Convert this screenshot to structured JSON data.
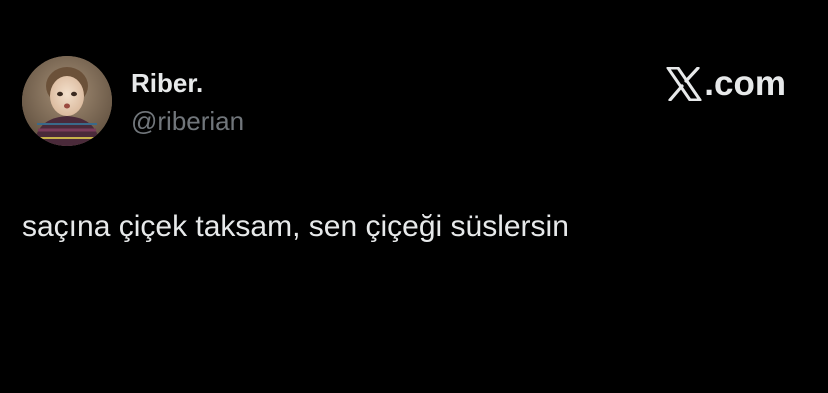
{
  "tweet": {
    "author": {
      "display_name": "Riber.",
      "handle": "@riberian",
      "avatar_icon": "child-portrait-avatar"
    },
    "brand": {
      "icon": "x-logo-icon",
      "label": ".com"
    },
    "text": "saçına çiçek taksam, sen çiçeği süslersin"
  },
  "colors": {
    "background": "#000000",
    "primary_text": "#e7e9ea",
    "secondary_text": "#71767b"
  }
}
